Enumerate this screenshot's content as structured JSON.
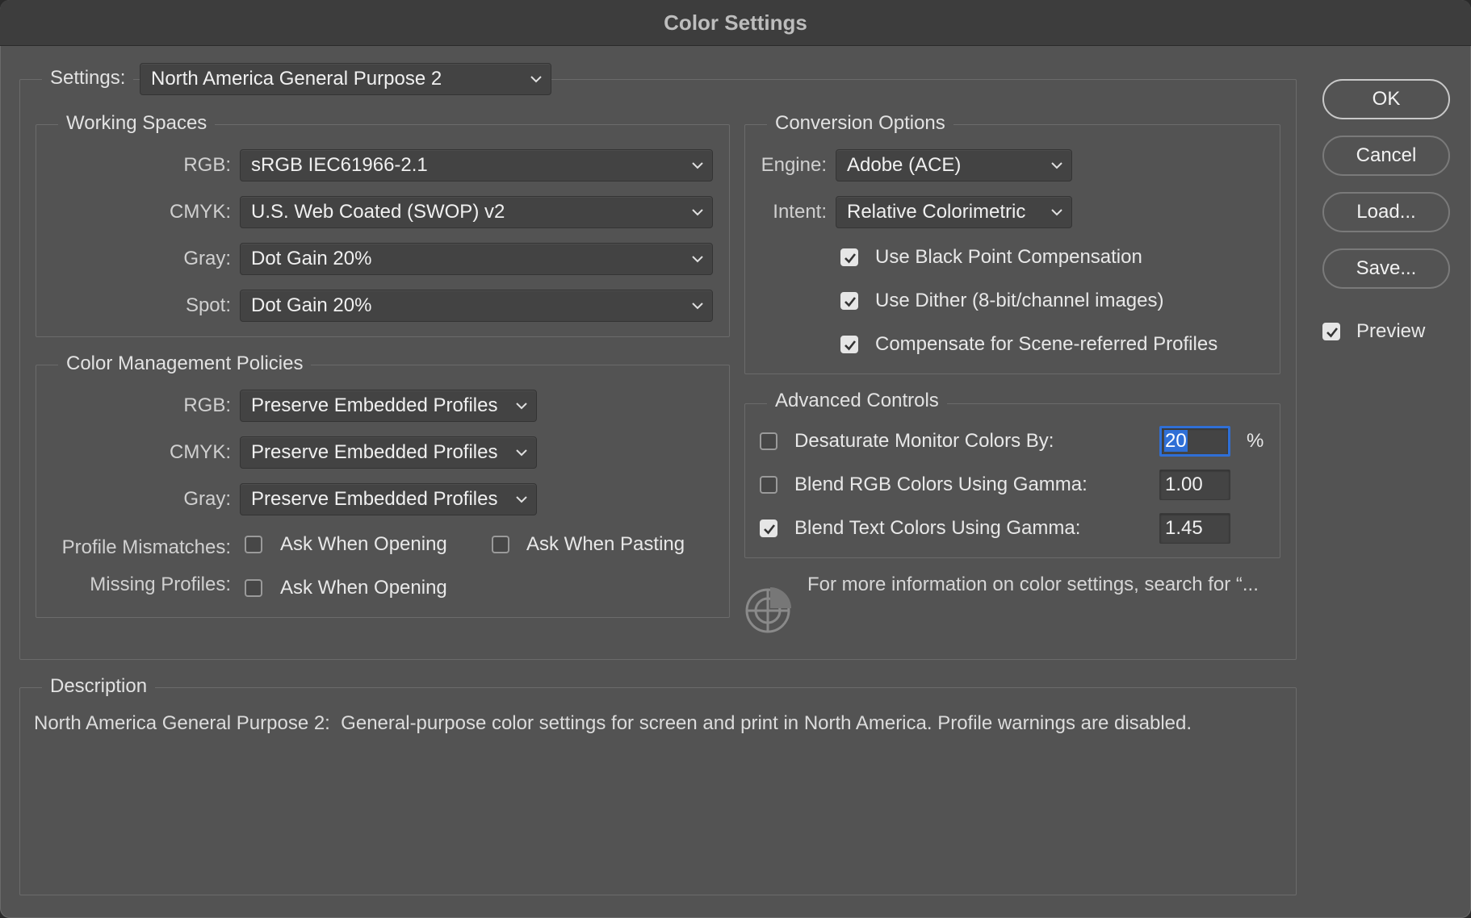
{
  "window": {
    "title": "Color Settings"
  },
  "settings": {
    "label": "Settings:",
    "value": "North America General Purpose 2"
  },
  "working_spaces": {
    "title": "Working Spaces",
    "rgb": {
      "label": "RGB:",
      "value": "sRGB IEC61966-2.1"
    },
    "cmyk": {
      "label": "CMYK:",
      "value": "U.S. Web Coated (SWOP) v2"
    },
    "gray": {
      "label": "Gray:",
      "value": "Dot Gain 20%"
    },
    "spot": {
      "label": "Spot:",
      "value": "Dot Gain 20%"
    }
  },
  "policies": {
    "title": "Color Management Policies",
    "rgb": {
      "label": "RGB:",
      "value": "Preserve Embedded Profiles"
    },
    "cmyk": {
      "label": "CMYK:",
      "value": "Preserve Embedded Profiles"
    },
    "gray": {
      "label": "Gray:",
      "value": "Preserve Embedded Profiles"
    },
    "mismatches": {
      "label": "Profile Mismatches:",
      "ask_opening": {
        "label": "Ask When Opening",
        "checked": false
      },
      "ask_pasting": {
        "label": "Ask When Pasting",
        "checked": false
      }
    },
    "missing": {
      "label": "Missing Profiles:",
      "ask_opening": {
        "label": "Ask When Opening",
        "checked": false
      }
    }
  },
  "conversion": {
    "title": "Conversion Options",
    "engine": {
      "label": "Engine:",
      "value": "Adobe (ACE)"
    },
    "intent": {
      "label": "Intent:",
      "value": "Relative Colorimetric"
    },
    "black_point": {
      "label": "Use Black Point Compensation",
      "checked": true
    },
    "dither": {
      "label": "Use Dither (8-bit/channel images)",
      "checked": true
    },
    "scene_referred": {
      "label": "Compensate for Scene-referred Profiles",
      "checked": true
    }
  },
  "advanced": {
    "title": "Advanced Controls",
    "desaturate": {
      "label": "Desaturate Monitor Colors By:",
      "checked": false,
      "value": "20",
      "unit": "%"
    },
    "blend_rgb": {
      "label": "Blend RGB Colors Using Gamma:",
      "checked": false,
      "value": "1.00"
    },
    "blend_text": {
      "label": "Blend Text Colors Using Gamma:",
      "checked": true,
      "value": "1.45"
    }
  },
  "info": {
    "text": "For more information on color settings, search for “..."
  },
  "description": {
    "title": "Description",
    "text": "North America General Purpose 2:  General-purpose color settings for screen and print in North America. Profile warnings are disabled."
  },
  "buttons": {
    "ok": "OK",
    "cancel": "Cancel",
    "load": "Load...",
    "save": "Save..."
  },
  "preview": {
    "label": "Preview",
    "checked": true
  },
  "colors": {
    "background": "#535353",
    "titlebar": "#3d3d3d",
    "focus": "#2f6fd6"
  }
}
